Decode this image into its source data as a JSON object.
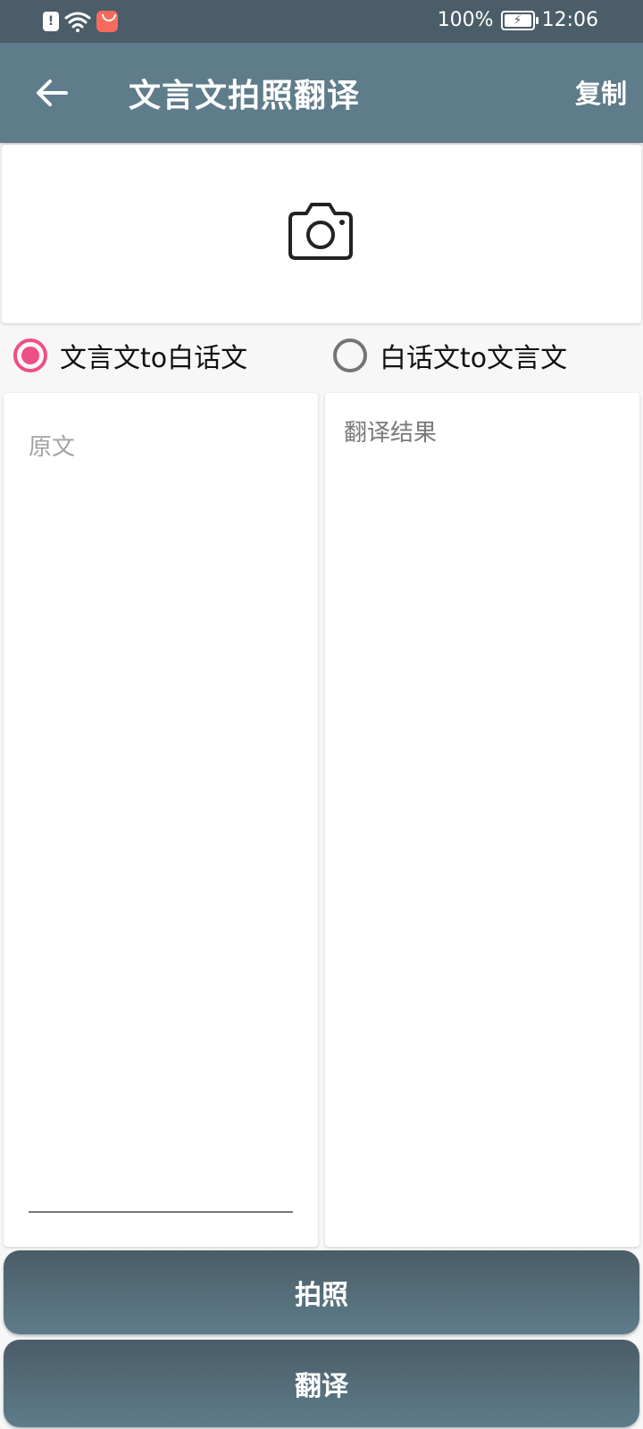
{
  "status_bar": {
    "battery_percent": "100%",
    "time": "12:06",
    "icons": [
      "notification-icon",
      "wifi-icon",
      "shop-icon",
      "battery-charging-icon"
    ]
  },
  "app_bar": {
    "title": "文言文拍照翻译",
    "copy_label": "复制",
    "back_icon": "arrow-back-icon"
  },
  "camera": {
    "icon": "camera-icon"
  },
  "mode": {
    "options": [
      {
        "label": "文言文to白话文",
        "checked": true
      },
      {
        "label": "白话文to文言文",
        "checked": false
      }
    ],
    "accent_color": "#ef4f87"
  },
  "source": {
    "value": "",
    "placeholder": "原文"
  },
  "result": {
    "text": "翻译结果"
  },
  "buttons": {
    "photo_label": "拍照",
    "translate_label": "翻译"
  },
  "colors": {
    "app_bar": "#5f7c8a",
    "status_bar": "#4a5d68"
  }
}
